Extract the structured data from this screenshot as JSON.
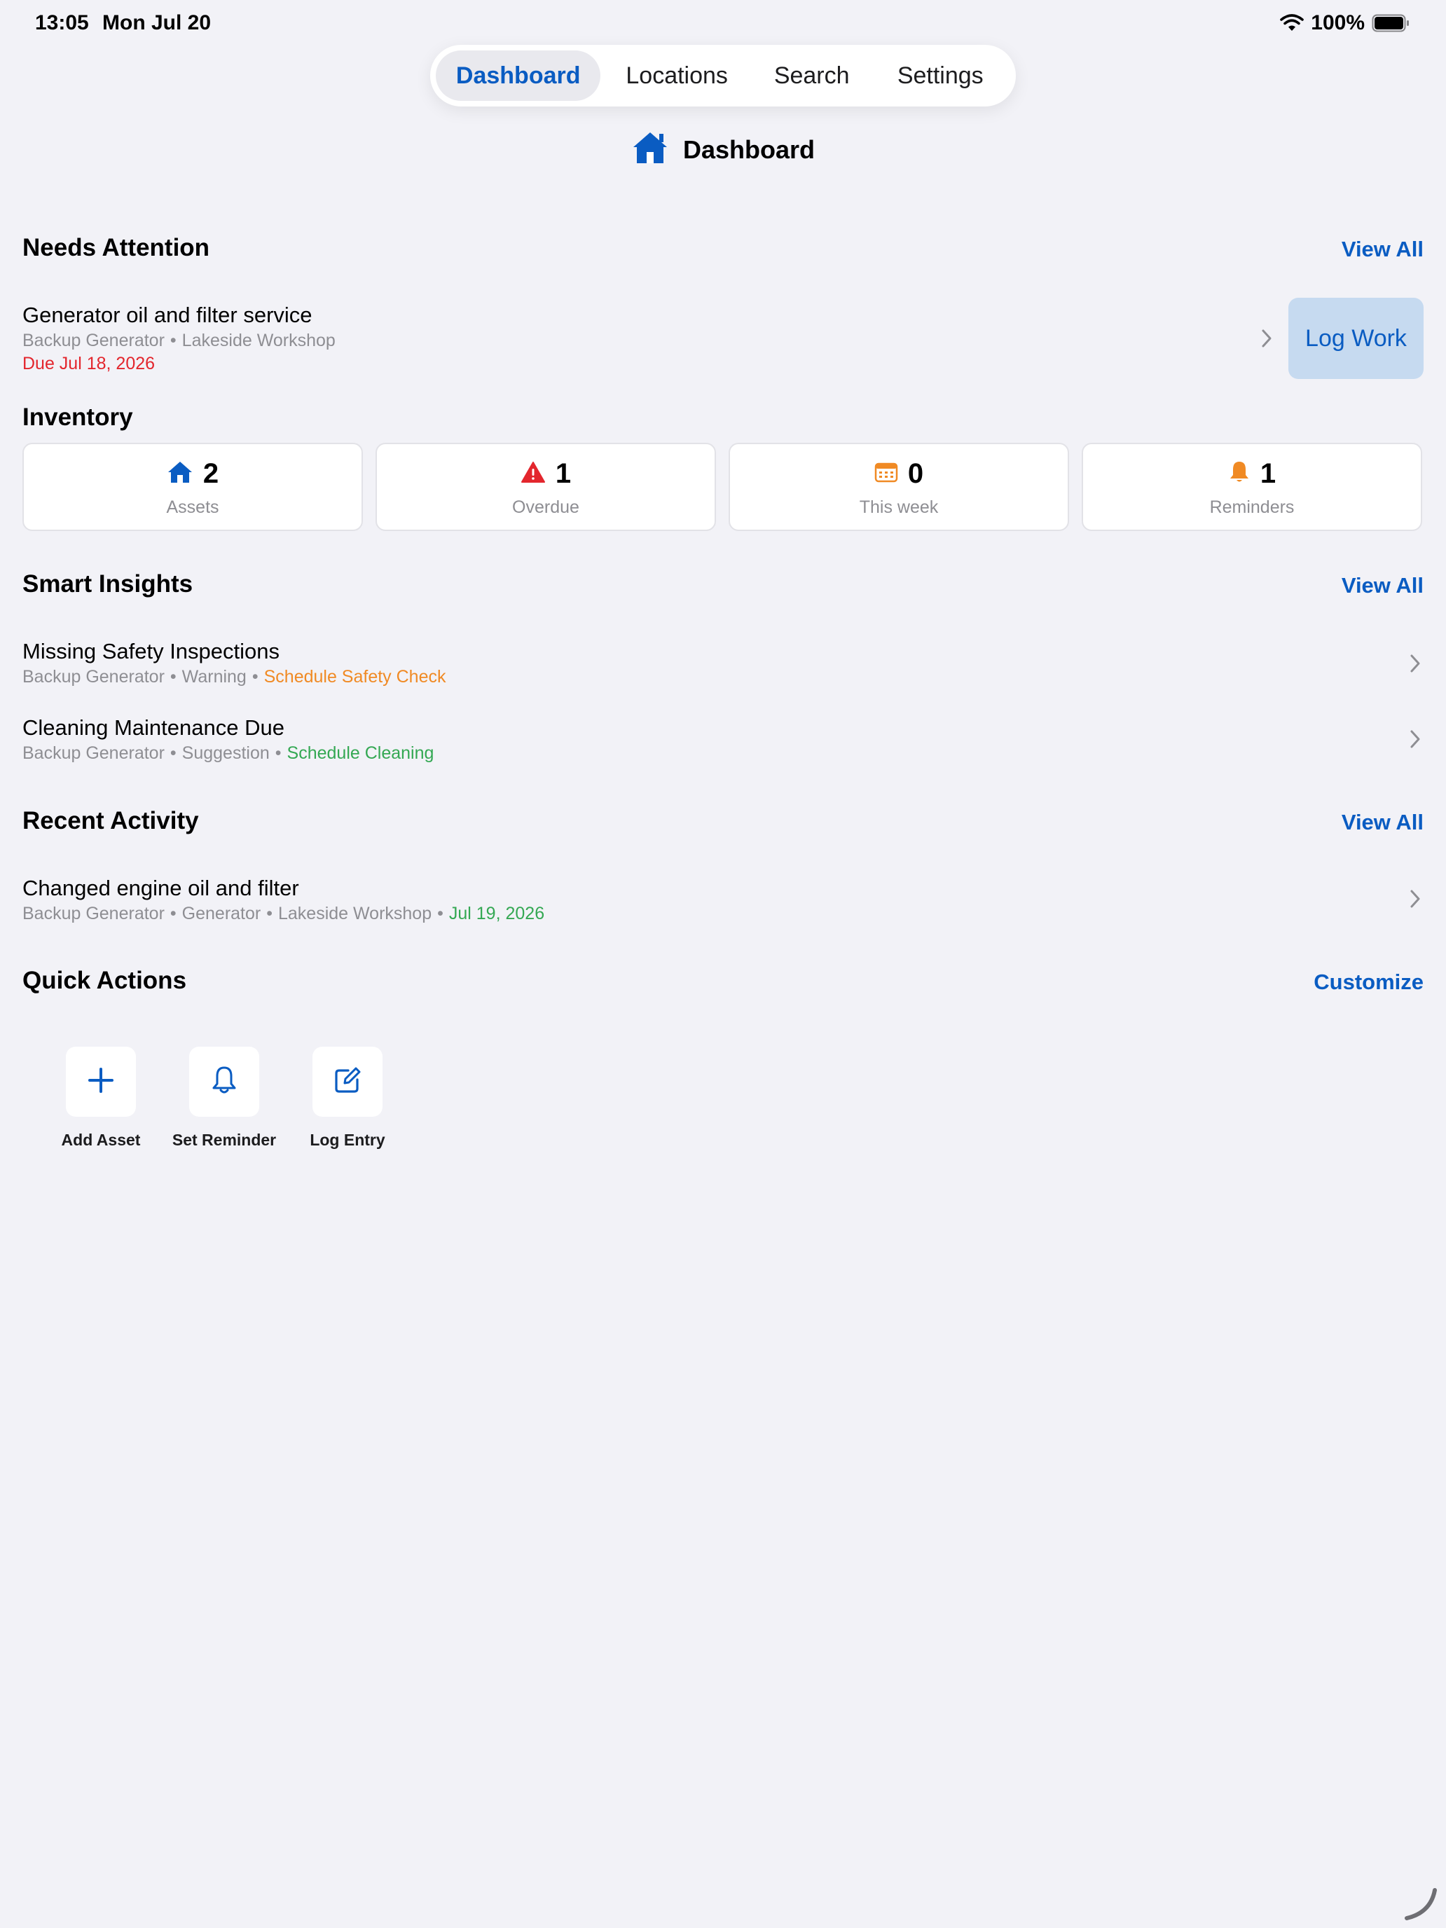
{
  "status_bar": {
    "time": "13:05",
    "date": "Mon Jul 20",
    "battery": "100%"
  },
  "tabs": [
    {
      "label": "Dashboard",
      "active": true
    },
    {
      "label": "Locations",
      "active": false
    },
    {
      "label": "Search",
      "active": false
    },
    {
      "label": "Settings",
      "active": false
    }
  ],
  "page": {
    "title": "Dashboard",
    "icon": "house-icon"
  },
  "needs_attention": {
    "title": "Needs Attention",
    "action": "View All",
    "item": {
      "title": "Generator oil and filter service",
      "asset": "Backup Generator",
      "location": "Lakeside Workshop",
      "due": "Due Jul 18, 2026",
      "button": "Log Work"
    }
  },
  "inventory": {
    "title": "Inventory",
    "stats": [
      {
        "value": "2",
        "label": "Assets",
        "icon": "house-icon",
        "color": "#0a5cc2"
      },
      {
        "value": "1",
        "label": "Overdue",
        "icon": "warning-triangle-icon",
        "color": "#e3262d"
      },
      {
        "value": "0",
        "label": "This week",
        "icon": "calendar-icon",
        "color": "#f08a24"
      },
      {
        "value": "1",
        "label": "Reminders",
        "icon": "bell-icon",
        "color": "#f08a24"
      }
    ]
  },
  "smart_insights": {
    "title": "Smart Insights",
    "action": "View All",
    "items": [
      {
        "title": "Missing Safety Inspections",
        "asset": "Backup Generator",
        "level": "Warning",
        "action": "Schedule Safety Check",
        "action_color": "#f08a24"
      },
      {
        "title": "Cleaning Maintenance Due",
        "asset": "Backup Generator",
        "level": "Suggestion",
        "action": "Schedule Cleaning",
        "action_color": "#34a853"
      }
    ]
  },
  "recent_activity": {
    "title": "Recent Activity",
    "action": "View All",
    "item": {
      "title": "Changed engine oil and filter",
      "asset": "Backup Generator",
      "category": "Generator",
      "location": "Lakeside Workshop",
      "date": "Jul 19, 2026"
    }
  },
  "quick_actions": {
    "title": "Quick Actions",
    "action": "Customize",
    "items": [
      {
        "label": "Add Asset",
        "icon": "plus-icon"
      },
      {
        "label": "Set Reminder",
        "icon": "bell-outline-icon"
      },
      {
        "label": "Log Entry",
        "icon": "edit-square-icon"
      }
    ]
  },
  "colors": {
    "accent": "#0a5cc2",
    "background": "#f2f2f7",
    "danger": "#e3262d",
    "warning": "#f08a24",
    "success": "#34a853"
  }
}
